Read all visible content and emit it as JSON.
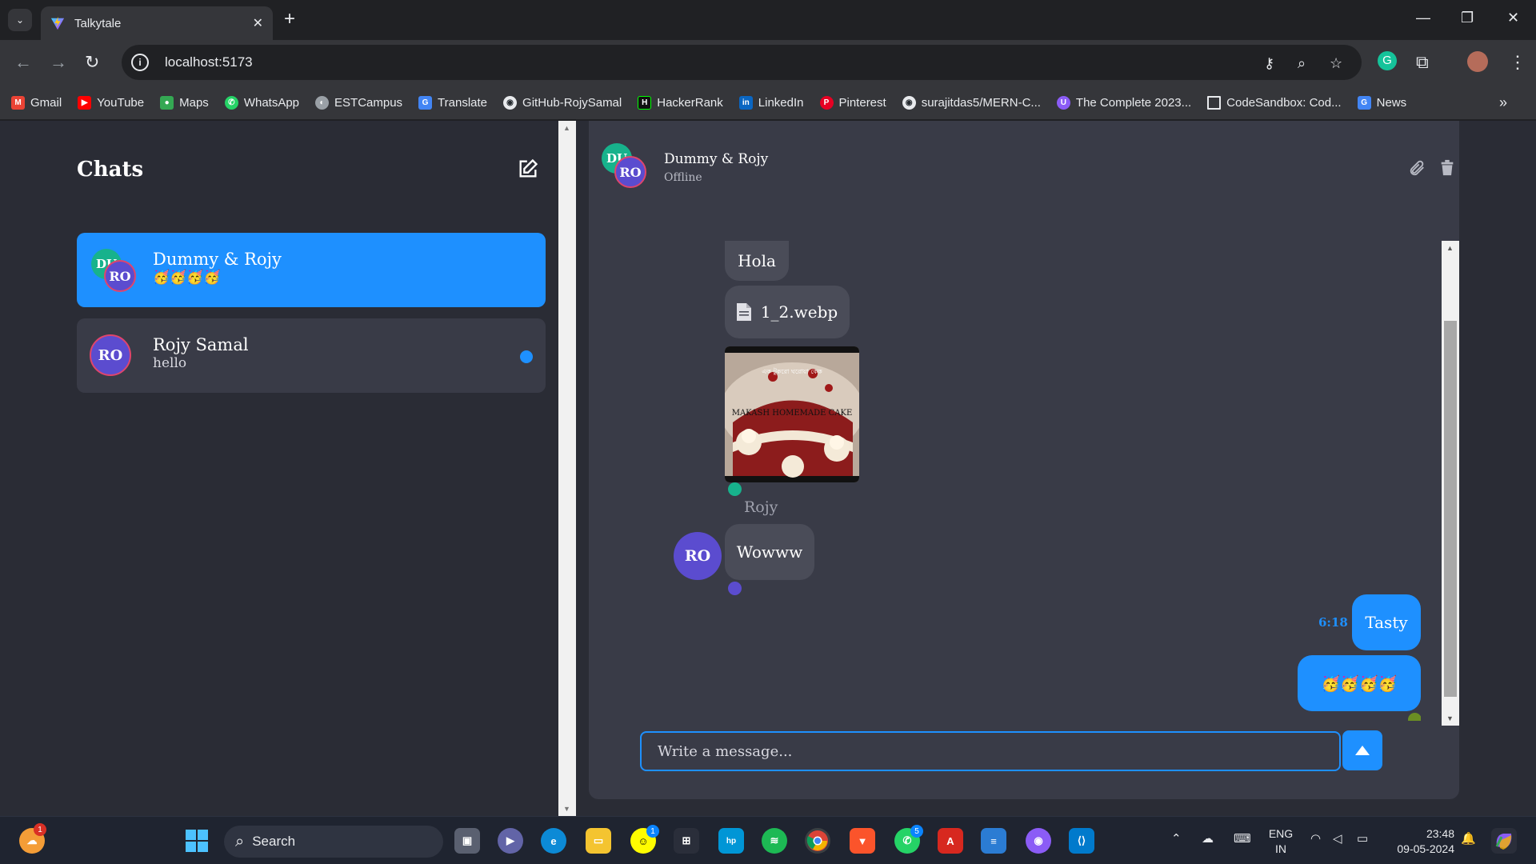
{
  "browser": {
    "tab_title": "Talkytale",
    "url": "localhost:5173",
    "bookmarks": [
      {
        "label": "Gmail",
        "color": "#ea4335",
        "glyph": "M"
      },
      {
        "label": "YouTube",
        "color": "#ff0000",
        "glyph": "▶"
      },
      {
        "label": "Maps",
        "color": "#34a853",
        "glyph": "●"
      },
      {
        "label": "WhatsApp",
        "color": "#25d366",
        "glyph": "✆"
      },
      {
        "label": "ESTCampus",
        "color": "#9aa0a6",
        "glyph": "◐"
      },
      {
        "label": "Translate",
        "color": "#4285f4",
        "glyph": "G"
      },
      {
        "label": "GitHub-RojySamal",
        "color": "#24292e",
        "glyph": "◉"
      },
      {
        "label": "HackerRank",
        "color": "#111",
        "glyph": "H"
      },
      {
        "label": "LinkedIn",
        "color": "#0a66c2",
        "glyph": "in"
      },
      {
        "label": "Pinterest",
        "color": "#e60023",
        "glyph": "P"
      },
      {
        "label": "surajitdas5/MERN-C...",
        "color": "#24292e",
        "glyph": "◉"
      },
      {
        "label": "The Complete 2023...",
        "color": "#8b5cf6",
        "glyph": "U"
      },
      {
        "label": "CodeSandbox: Cod...",
        "color": "#35363a",
        "glyph": "□"
      },
      {
        "label": "News",
        "color": "#4285f4",
        "glyph": "G"
      }
    ]
  },
  "sidebar": {
    "title": "Chats",
    "chats": [
      {
        "name": "Dummy & Rojy",
        "preview": "🥳🥳🥳🥳",
        "avatar1": "DU",
        "avatar2": "RO",
        "active": true
      },
      {
        "name": "Rojy Samal",
        "preview": "hello",
        "avatar1": "RO",
        "unread": true
      }
    ]
  },
  "chat": {
    "name": "Dummy & Rojy",
    "status": "Offline",
    "avatar1": "DU",
    "avatar2": "RO",
    "messages": {
      "hola": "Hola",
      "file_name": "1_2.webp",
      "image_caption_top": "এক টুকরো ঘরোয়া কেক",
      "image_caption_main": "MAKASH HOMEMADE CAKE",
      "sender_name": "Rojy",
      "sender_avatar": "RO",
      "wowww": "Wowww",
      "tasty": "Tasty",
      "tasty_time": "6:18 PM",
      "emoji_msg": "🥳🥳🥳🥳"
    },
    "input_placeholder": "Write a message..."
  },
  "colors": {
    "accent": "#1e90ff",
    "panel": "#393b47",
    "sidebar_bg": "#2a2c35",
    "avatar_green": "#17b28c",
    "avatar_purple": "#5b4ccf"
  },
  "taskbar": {
    "search_label": "Search",
    "lang_line1": "ENG",
    "lang_line2": "IN",
    "time": "23:48",
    "date": "09-05-2024",
    "notification_badge": "1",
    "snap_badge": "1",
    "whatsapp_badge": "5"
  }
}
